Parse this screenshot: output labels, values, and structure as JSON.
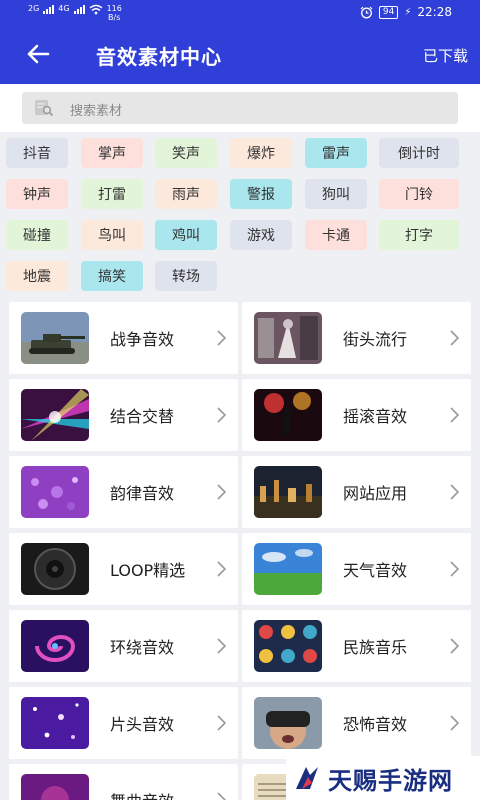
{
  "status_bar": {
    "net1": "2G",
    "net2": "4G",
    "speed": "116",
    "speed_unit": "B/s",
    "battery": "94",
    "time": "22:28"
  },
  "header": {
    "title": "音效素材中心",
    "action": "已下载",
    "back_icon": "arrow-left-icon"
  },
  "search": {
    "placeholder": "搜索素材",
    "icon": "search-icon"
  },
  "tags": [
    {
      "label": "抖音",
      "color": "#dfe3ee"
    },
    {
      "label": "掌声",
      "color": "#fde0dc"
    },
    {
      "label": "笑声",
      "color": "#e3f5d8"
    },
    {
      "label": "爆炸",
      "color": "#fde8dc"
    },
    {
      "label": "雷声",
      "color": "#a9e6ee"
    },
    {
      "label": "倒计时",
      "color": "#dfe3ee"
    },
    {
      "label": "钟声",
      "color": "#fde0dc"
    },
    {
      "label": "打雷",
      "color": "#e3f5d8"
    },
    {
      "label": "雨声",
      "color": "#fde8dc"
    },
    {
      "label": "警报",
      "color": "#a9e6ee"
    },
    {
      "label": "狗叫",
      "color": "#dfe3ee"
    },
    {
      "label": "门铃",
      "color": "#fde0dc"
    },
    {
      "label": "碰撞",
      "color": "#e3f5d8"
    },
    {
      "label": "鸟叫",
      "color": "#fde8dc"
    },
    {
      "label": "鸡叫",
      "color": "#a9e6ee"
    },
    {
      "label": "游戏",
      "color": "#dfe3ee"
    },
    {
      "label": "卡通",
      "color": "#fde0dc"
    },
    {
      "label": "打字",
      "color": "#e3f5d8"
    },
    {
      "label": "地震",
      "color": "#fde8dc"
    },
    {
      "label": "搞笑",
      "color": "#a9e6ee"
    },
    {
      "label": "转场",
      "color": "#dfe3ee"
    }
  ],
  "categories": [
    {
      "label": "战争音效",
      "icon": "tank-thumbnail"
    },
    {
      "label": "街头流行",
      "icon": "street-art-thumbnail"
    },
    {
      "label": "结合交替",
      "icon": "light-rays-thumbnail"
    },
    {
      "label": "摇滚音效",
      "icon": "concert-stage-thumbnail"
    },
    {
      "label": "韵律音效",
      "icon": "purple-drops-thumbnail"
    },
    {
      "label": "网站应用",
      "icon": "city-night-thumbnail"
    },
    {
      "label": "LOOP精选",
      "icon": "speaker-thumbnail"
    },
    {
      "label": "天气音效",
      "icon": "sky-field-thumbnail"
    },
    {
      "label": "环绕音效",
      "icon": "swirl-thumbnail"
    },
    {
      "label": "民族音乐",
      "icon": "ethnic-pattern-thumbnail"
    },
    {
      "label": "片头音效",
      "icon": "sparkle-thumbnail"
    },
    {
      "label": "恐怖音效",
      "icon": "vr-headset-thumbnail"
    },
    {
      "label": "舞曲音效",
      "icon": "dance-thumbnail"
    },
    {
      "label": "",
      "icon": "music-score-thumbnail"
    }
  ],
  "watermark": {
    "text": "天赐手游网"
  }
}
